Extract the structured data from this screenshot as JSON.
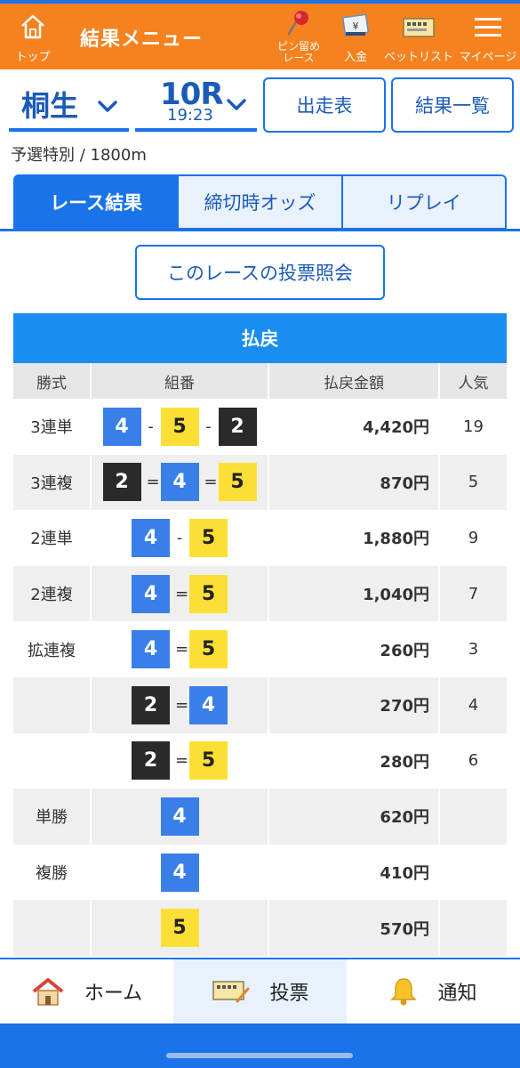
{
  "header": {
    "top_label": "トップ",
    "title": "結果メニュー",
    "pin_label": "ピン留め\nレース",
    "deposit_label": "入金",
    "betlist_label": "ベットリスト",
    "mypage_label": "マイページ",
    "bg_color": "#f5821f"
  },
  "race": {
    "place": "桐生",
    "number": "10R",
    "time": "19:23",
    "entries_btn": "出走表",
    "results_btn": "結果一覧",
    "info": "予選特別 / 1800m"
  },
  "tabs": [
    "レース結果",
    "締切時オッズ",
    "リプレイ"
  ],
  "inquiry_btn": "このレースの投票照会",
  "payout": {
    "title": "払戻",
    "headers": [
      "勝式",
      "組番",
      "払戻金額",
      "人気"
    ],
    "rows": [
      {
        "type": "3連単",
        "nums": [
          4,
          5,
          2
        ],
        "sep": "-",
        "amount": "4,420円",
        "pop": "19"
      },
      {
        "type": "3連複",
        "nums": [
          2,
          4,
          5
        ],
        "sep": "=",
        "amount": "870円",
        "pop": "5"
      },
      {
        "type": "2連単",
        "nums": [
          4,
          5
        ],
        "sep": "-",
        "amount": "1,880円",
        "pop": "9"
      },
      {
        "type": "2連複",
        "nums": [
          4,
          5
        ],
        "sep": "=",
        "amount": "1,040円",
        "pop": "7"
      },
      {
        "type": "拡連複",
        "nums": [
          4,
          5
        ],
        "sep": "=",
        "amount": "260円",
        "pop": "3"
      },
      {
        "type": "",
        "nums": [
          2,
          4
        ],
        "sep": "=",
        "amount": "270円",
        "pop": "4"
      },
      {
        "type": "",
        "nums": [
          2,
          5
        ],
        "sep": "=",
        "amount": "280円",
        "pop": "6"
      },
      {
        "type": "単勝",
        "nums": [
          4
        ],
        "sep": "",
        "amount": "620円",
        "pop": ""
      },
      {
        "type": "複勝",
        "nums": [
          4
        ],
        "sep": "",
        "amount": "410円",
        "pop": ""
      },
      {
        "type": "",
        "nums": [
          5
        ],
        "sep": "",
        "amount": "570円",
        "pop": ""
      }
    ]
  },
  "bottom_nav": {
    "home": "ホーム",
    "vote": "投票",
    "notify": "通知"
  },
  "icons": [
    "home-icon",
    "pin-icon",
    "yen-ticket-icon",
    "bet-list-icon",
    "hamburger-menu-icon",
    "chevron-down-icon",
    "bell-icon",
    "ticket-icon"
  ],
  "colors": {
    "accent": "#1a73e8",
    "header": "#f5821f"
  }
}
